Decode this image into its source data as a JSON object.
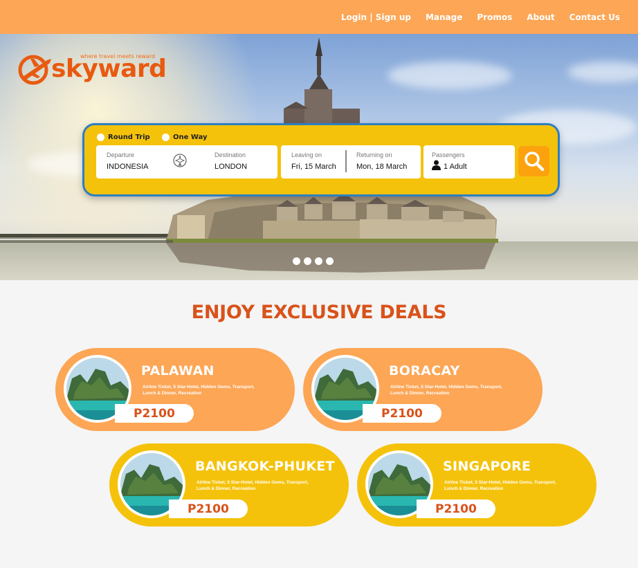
{
  "nav": {
    "items": [
      "Login | Sign up",
      "Manage",
      "Promos",
      "About",
      "Contact Us"
    ]
  },
  "brand": {
    "name": "skyward",
    "tagline": "where travel meets reward",
    "color": "#e85a10"
  },
  "search": {
    "trip_types": [
      "Round Trip",
      "One Way"
    ],
    "departure": {
      "label": "Departure",
      "value": "INDONESIA"
    },
    "destination": {
      "label": "Destination",
      "value": "LONDON"
    },
    "leaving": {
      "label": "Leaving on",
      "value": "Fri, 15 March"
    },
    "returning": {
      "label": "Returning on",
      "value": "Mon, 18 March"
    },
    "passengers": {
      "label": "Passengers",
      "value": "1 Adult"
    }
  },
  "carousel": {
    "dots": 4
  },
  "deals": {
    "title": "ENJOY EXCLUSIVE DEALS",
    "items": [
      {
        "name": "PALAWAN",
        "desc": "Airline Ticket, 5 Star-Hotel, Hidden Gems, Transport, Lunch & Dinner, Recreation",
        "price": "P2100",
        "color": "#fca656"
      },
      {
        "name": "BORACAY",
        "desc": "Airline Ticket, 5 Star-Hotel, Hidden Gems, Transport, Lunch & Dinner, Recreation",
        "price": "P2100",
        "color": "#fca656"
      },
      {
        "name": "BANGKOK-PHUKET",
        "desc": "Airline Ticket, 5 Star-Hotel, Hidden Gems, Transport, Lunch & Dinner, Recreation",
        "price": "P2100",
        "color": "#f5c20b"
      },
      {
        "name": "SINGAPORE",
        "desc": "Airline Ticket, 5 Star-Hotel, Hidden Gems, Transport, Lunch & Dinner, Recreation",
        "price": "P2100",
        "color": "#f5c20b"
      }
    ]
  },
  "colors": {
    "topbar": "#fca656",
    "accent_yellow": "#f5c20b",
    "title_red": "#d9521a",
    "search_border": "#2d7fc1"
  }
}
